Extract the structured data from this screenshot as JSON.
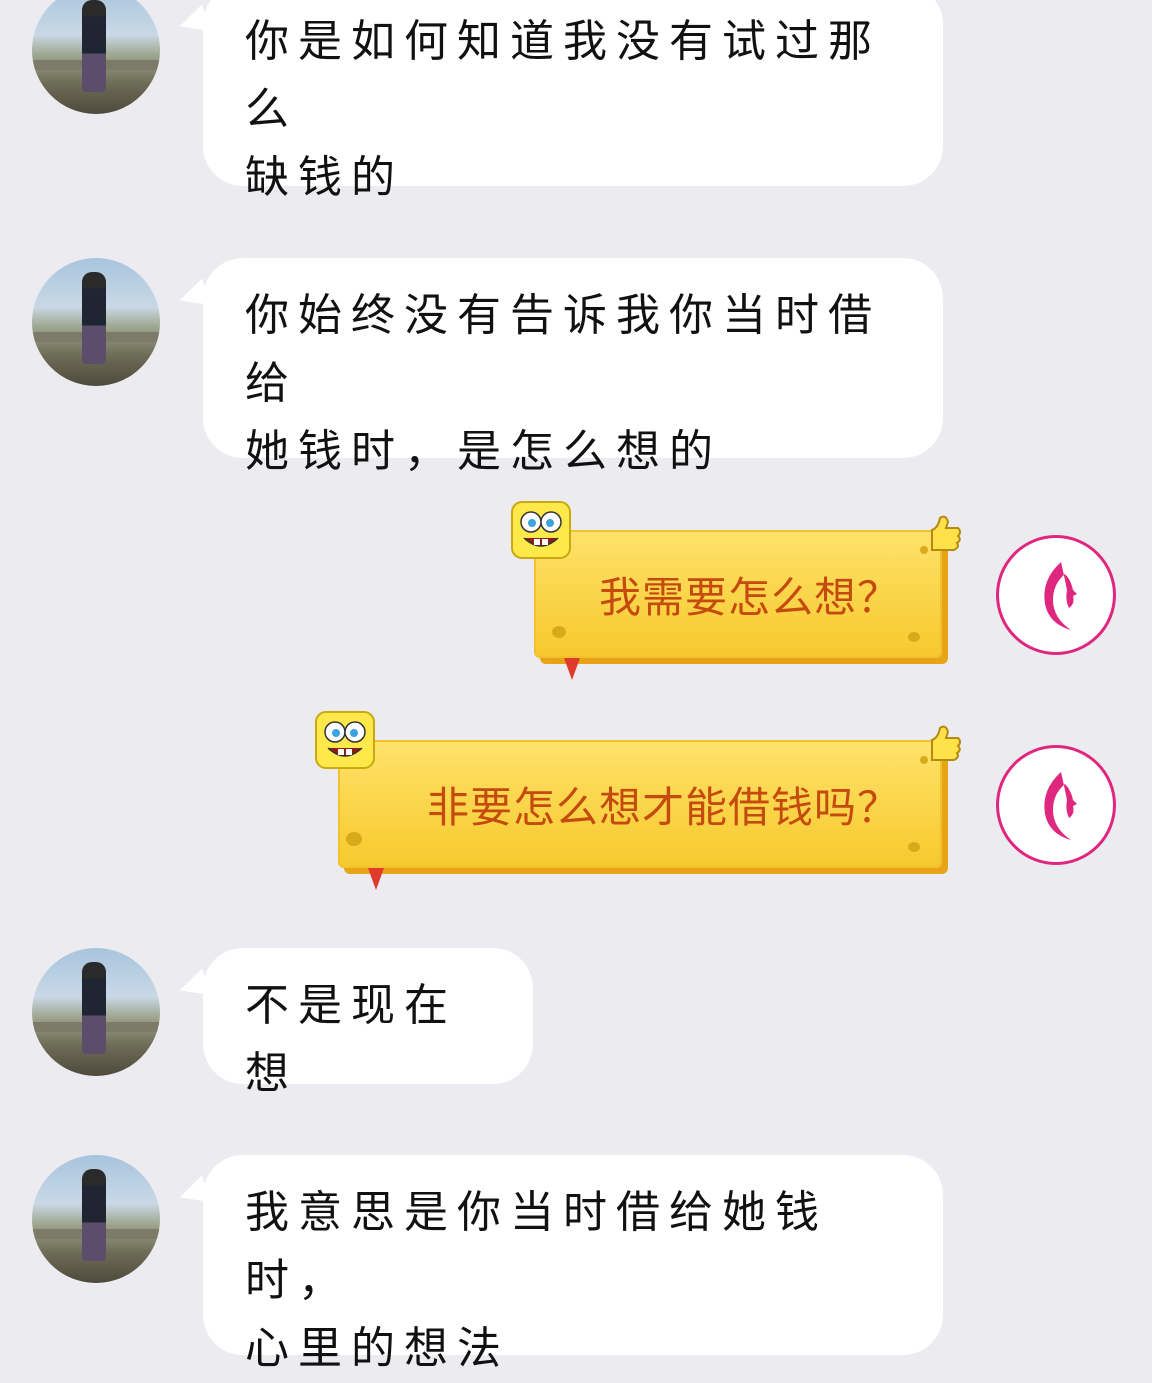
{
  "messages": [
    {
      "side": "left",
      "text_line1": "你是如何知道我没有试过那么",
      "text_line2": "缺钱的"
    },
    {
      "side": "left",
      "text_line1": "你始终没有告诉我你当时借给",
      "text_line2": "她钱时，是怎么想的"
    },
    {
      "side": "right",
      "text": "我需要怎么想？"
    },
    {
      "side": "right",
      "text": "非要怎么想才能借钱吗？"
    },
    {
      "side": "left",
      "text_line1": "不是现在想"
    },
    {
      "side": "left",
      "text_line1": "我意思是你当时借给她钱时，",
      "text_line2": "心里的想法"
    }
  ],
  "icons": {
    "left_avatar": "user-photo-avatar",
    "right_avatar": "pink-face-logo-avatar",
    "bubble_decoration": "spongebob-face-icon"
  },
  "colors": {
    "background": "#ebebf0",
    "right_text": "#c44a0d",
    "bubble_yellow": "#f6c92c",
    "logo_pink": "#e0277f"
  }
}
